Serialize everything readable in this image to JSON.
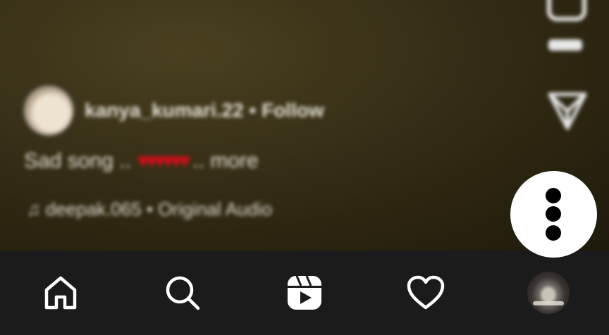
{
  "reel": {
    "author": {
      "username": "kanya_kumari.22",
      "separator": "•",
      "follow_label": "Follow"
    },
    "caption": {
      "text": "Sad song ..",
      "hearts": "♥♥♥♥♥♥",
      "more_label": ".. more"
    },
    "audio": {
      "icon": "music-note-icon",
      "text": "deepak.065 • Original Audio"
    },
    "side_actions": [
      "comment-icon",
      "send-icon"
    ]
  },
  "overlay": {
    "menu_button": "more-options-icon"
  },
  "bottom_nav": {
    "items": [
      {
        "name": "home",
        "icon": "home-icon"
      },
      {
        "name": "search",
        "icon": "search-icon"
      },
      {
        "name": "reels",
        "icon": "reels-icon"
      },
      {
        "name": "activity",
        "icon": "heart-icon"
      },
      {
        "name": "profile",
        "icon": "profile-avatar"
      }
    ],
    "background": "#1b1b1b",
    "icon_color": "#ffffff"
  },
  "colors": {
    "reel_bg": "#3a3218",
    "heart_red": "#c8101a"
  }
}
